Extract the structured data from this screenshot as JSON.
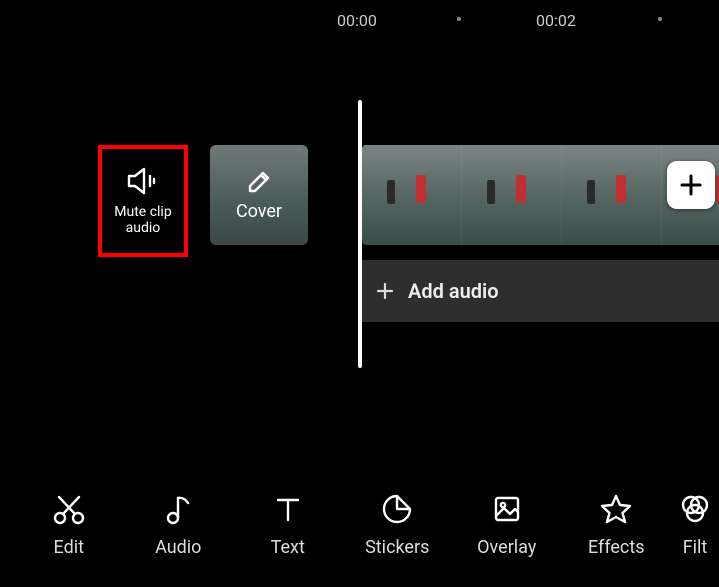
{
  "ruler": {
    "t0": "00:00",
    "t1": "00:02"
  },
  "mute": {
    "label_line1": "Mute clip",
    "label_line2": "audio"
  },
  "cover": {
    "label": "Cover"
  },
  "add_clip": {
    "plus": "+"
  },
  "audio_track": {
    "label": "Add audio"
  },
  "toolbar": {
    "items": [
      {
        "name": "edit",
        "label": "Edit"
      },
      {
        "name": "audio",
        "label": "Audio"
      },
      {
        "name": "text",
        "label": "Text"
      },
      {
        "name": "stickers",
        "label": "Stickers"
      },
      {
        "name": "overlay",
        "label": "Overlay"
      },
      {
        "name": "effects",
        "label": "Effects"
      },
      {
        "name": "filters",
        "label": "Filt"
      }
    ]
  }
}
